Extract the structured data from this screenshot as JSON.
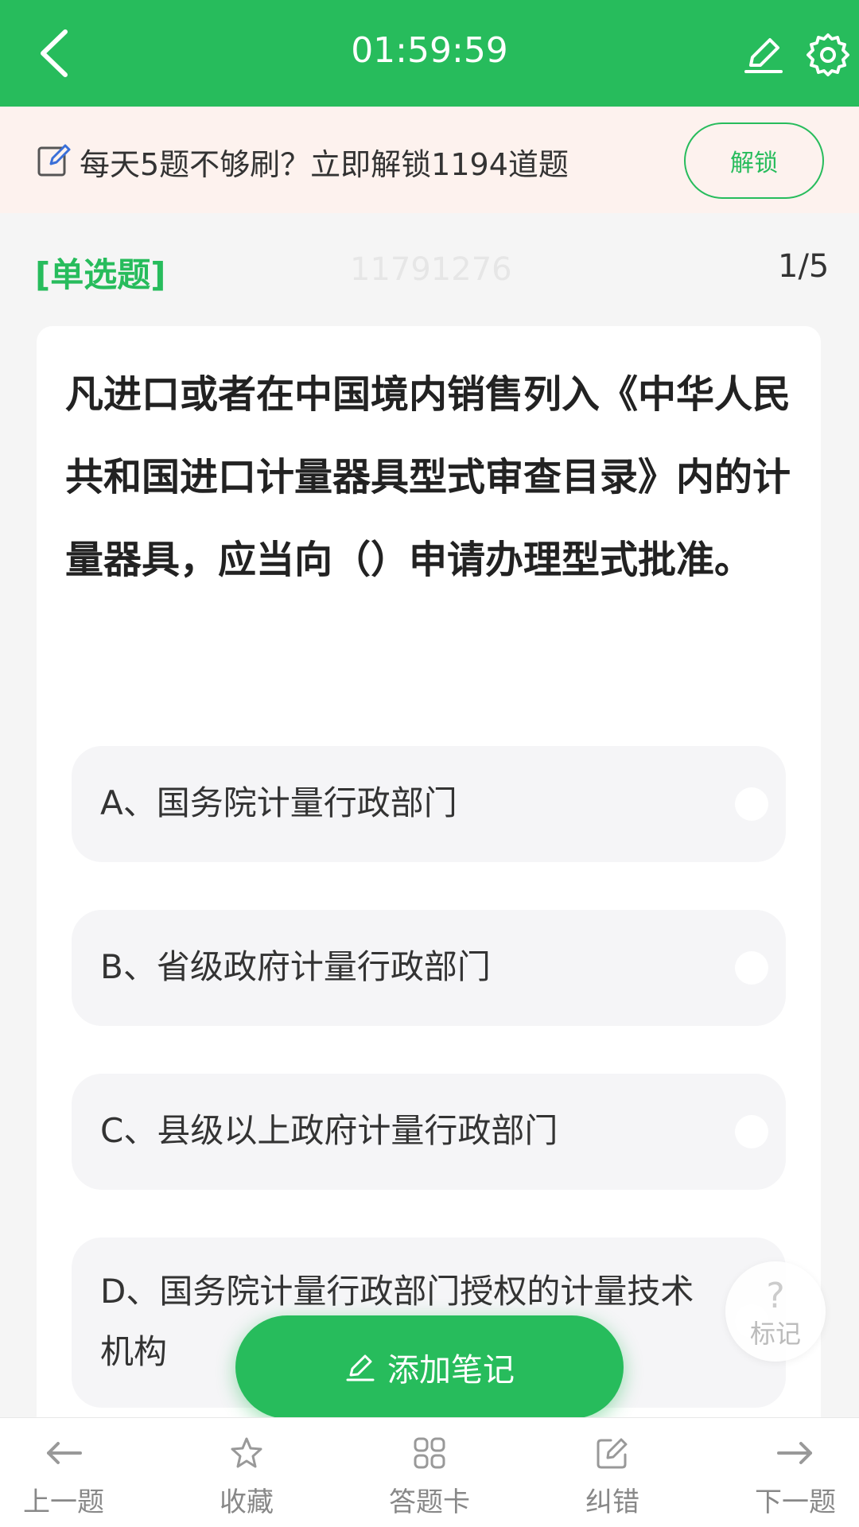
{
  "header": {
    "timer": "01:59:59",
    "back_icon": "back-chevron-icon",
    "edit_icon": "pencil-icon",
    "settings_icon": "gear-icon"
  },
  "promo": {
    "text": "每天5题不够刷？立即解锁1194道题",
    "button": "解锁"
  },
  "question": {
    "type": "[单选题]",
    "id": "11791276",
    "progress": "1/5",
    "text": "凡进口或者在中国境内销售列入《中华人民共和国进口计量器具型式审查目录》内的计量器具，应当向（）申请办理型式批准。",
    "options": [
      {
        "label": "A、国务院计量行政部门"
      },
      {
        "label": "B、省级政府计量行政部门"
      },
      {
        "label": "C、县级以上政府计量行政部门"
      },
      {
        "label": "D、国务院计量行政部门授权的计量技术机构"
      }
    ]
  },
  "mark": {
    "symbol": "?",
    "label": "标记"
  },
  "add_note": {
    "label": "添加笔记"
  },
  "bottom_nav": [
    {
      "label": "上一题",
      "icon": "arrow-left-icon"
    },
    {
      "label": "收藏",
      "icon": "star-icon"
    },
    {
      "label": "答题卡",
      "icon": "grid-icon"
    },
    {
      "label": "纠错",
      "icon": "edit-box-icon"
    },
    {
      "label": "下一题",
      "icon": "arrow-right-icon"
    }
  ],
  "colors": {
    "accent": "#27bc5c",
    "promo_bg": "#fdf2ee",
    "page_bg": "#f5f5f5"
  }
}
